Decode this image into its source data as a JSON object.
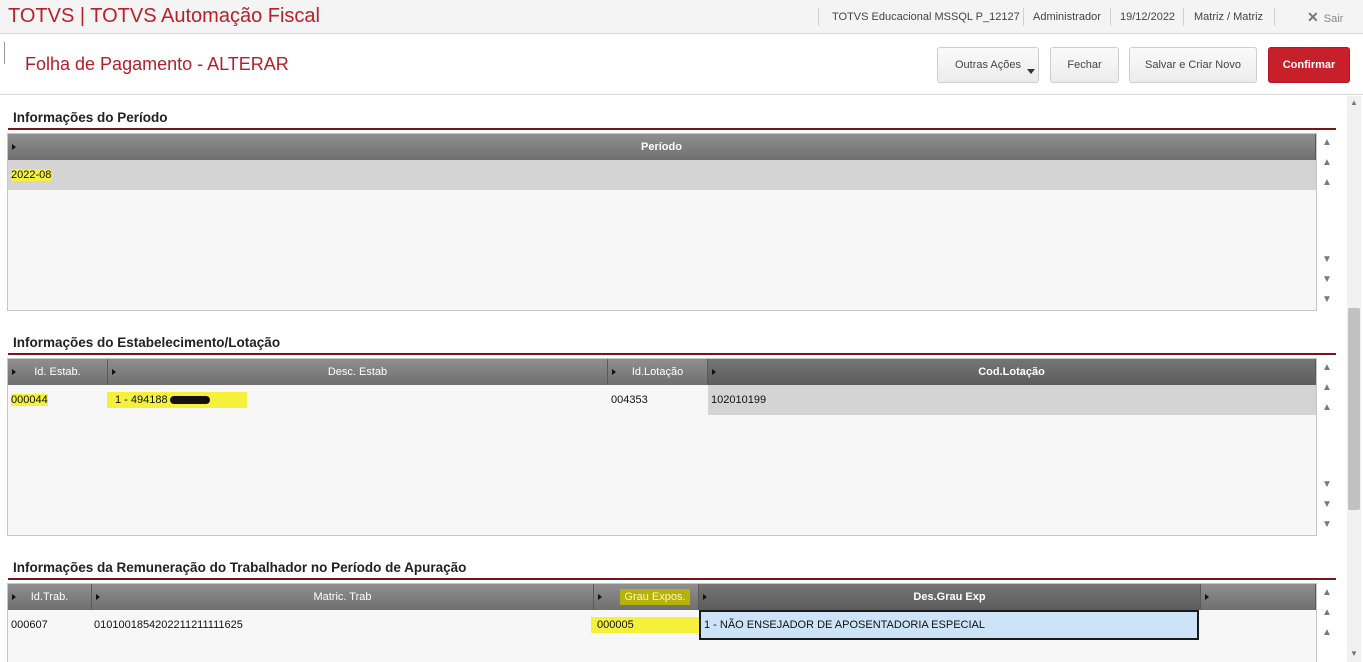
{
  "app": {
    "title": "TOTVS | TOTVS Automação Fiscal",
    "environment": "TOTVS Educacional MSSQL P_12127",
    "user": "Administrador",
    "date": "19/12/2022",
    "branch": "Matriz / Matriz",
    "logout": "Sair"
  },
  "page": {
    "title": "Folha de Pagamento - ALTERAR",
    "buttons": {
      "more_actions": "Outras Ações",
      "close": "Fechar",
      "save_new": "Salvar e Criar Novo",
      "confirm": "Confirmar"
    }
  },
  "periodo": {
    "title": "Informações do Período",
    "header": "Período",
    "rows": [
      {
        "periodo": "2022-08"
      }
    ]
  },
  "estab": {
    "title": "Informações do Estabelecimento/Lotação",
    "headers": {
      "id": "Id. Estab.",
      "desc": "Desc. Estab",
      "id_lot": "Id.Lotação",
      "cod_lot": "Cod.Lotação"
    },
    "rows": [
      {
        "id": "000044",
        "desc": "1 - 494188",
        "id_lot": "004353",
        "cod_lot": "102010199"
      }
    ]
  },
  "remun": {
    "title": "Informações da Remuneração do Trabalhador no Período de Apuração",
    "headers": {
      "id": "Id.Trab.",
      "matric": "Matric. Trab",
      "grau": "Grau Expos.",
      "des_grau": "Des.Grau Exp"
    },
    "rows": [
      {
        "id": "000607",
        "matric": "0101001854202211211111625",
        "grau": "000005",
        "des_grau": "1  - NÃO ENSEJADOR DE APOSENTADORIA ESPECIAL"
      }
    ]
  },
  "icons": {
    "scroll_top": "▲",
    "scroll_up": "▲",
    "scroll_down": "▼",
    "scroll_bottom": "▼",
    "close": "✕"
  },
  "colors": {
    "brand": "#b8202b",
    "highlight": "#f5f03a",
    "confirm": "#c8202b"
  }
}
